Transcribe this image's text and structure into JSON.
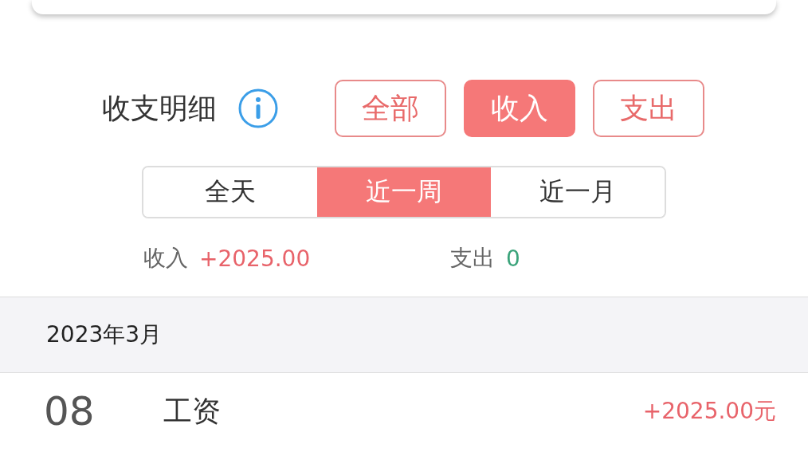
{
  "section": {
    "title": "收支明细"
  },
  "type_filters": [
    {
      "label": "全部",
      "selected": false
    },
    {
      "label": "收入",
      "selected": true
    },
    {
      "label": "支出",
      "selected": false
    }
  ],
  "range_tabs": [
    {
      "label": "全天",
      "selected": false
    },
    {
      "label": "近一周",
      "selected": true
    },
    {
      "label": "近一月",
      "selected": false
    }
  ],
  "totals": [
    {
      "label": "收入",
      "value": "+2025.00",
      "kind": "income"
    },
    {
      "label": "支出",
      "value": "0",
      "kind": "expense"
    }
  ],
  "month": "2023年3月",
  "records": [
    {
      "day": "08",
      "title": "工资",
      "amount": "+2025.00元",
      "kind": "income"
    }
  ]
}
